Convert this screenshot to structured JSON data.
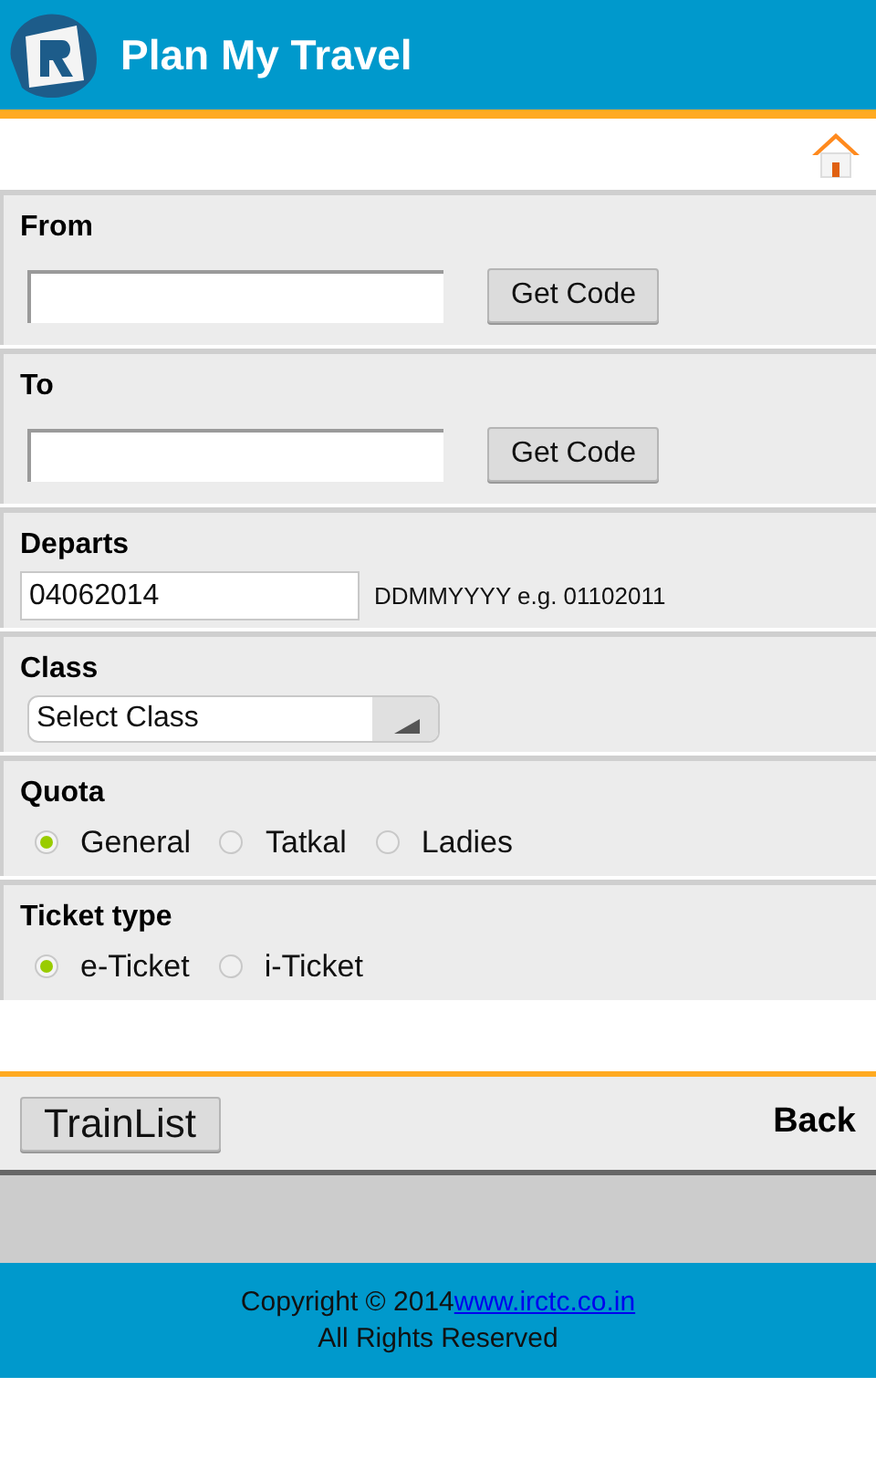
{
  "header": {
    "title": "Plan My Travel"
  },
  "sections": [
    {
      "kind": "station",
      "label": "From",
      "button": "Get Code"
    },
    {
      "kind": "station",
      "label": "To",
      "button": "Get Code"
    },
    {
      "kind": "date",
      "label": "Departs",
      "value": "04062014",
      "hint": "DDMMYYYY e.g. 01102011"
    },
    {
      "kind": "select",
      "label": "Class",
      "value": "Select Class"
    },
    {
      "kind": "radio",
      "label": "Quota",
      "options": [
        {
          "label": "General",
          "selected": true
        },
        {
          "label": "Tatkal",
          "selected": false
        },
        {
          "label": "Ladies",
          "selected": false
        }
      ]
    },
    {
      "kind": "radio",
      "label": "Ticket type",
      "options": [
        {
          "label": "e-Ticket",
          "selected": true
        },
        {
          "label": "i-Ticket",
          "selected": false
        }
      ]
    }
  ],
  "actions": {
    "primary": "TrainList",
    "back": "Back"
  },
  "footer": {
    "copyright": "Copyright © 2014",
    "link": "www.irctc.co.in",
    "rights": "All Rights Reserved"
  }
}
